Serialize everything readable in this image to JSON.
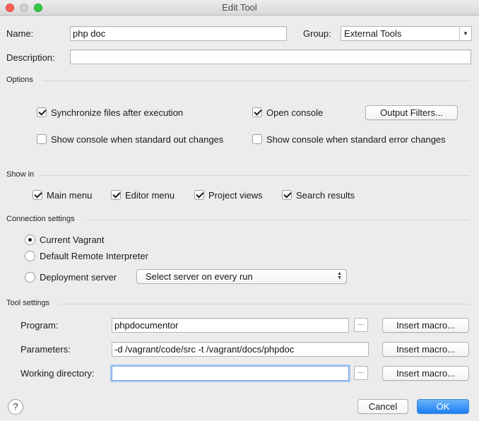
{
  "window": {
    "title": "Edit Tool",
    "close_color": "#fc5f57",
    "minimize_color": "#d0d0d0",
    "zoom_color": "#34c748"
  },
  "general": {
    "name_label": "Name:",
    "name_value": "php doc",
    "group_label": "Group:",
    "group_value": "External Tools",
    "description_label": "Description:",
    "description_value": ""
  },
  "options": {
    "section_title": "Options",
    "sync_files": {
      "label": "Synchronize files after execution",
      "checked": true
    },
    "open_console": {
      "label": "Open console",
      "checked": true
    },
    "output_filters_button": "Output Filters...",
    "show_console_stdout": {
      "label": "Show console when standard out changes",
      "checked": false
    },
    "show_console_stderr": {
      "label": "Show console when standard error changes",
      "checked": false
    }
  },
  "show_in": {
    "section_title": "Show in",
    "main_menu": {
      "label": "Main menu",
      "checked": true
    },
    "editor_menu": {
      "label": "Editor menu",
      "checked": true
    },
    "project_views": {
      "label": "Project views",
      "checked": true
    },
    "search_results": {
      "label": "Search results",
      "checked": true
    }
  },
  "connection": {
    "section_title": "Connection settings",
    "current_vagrant": {
      "label": "Current Vagrant",
      "selected": true
    },
    "default_remote": {
      "label": "Default Remote Interpreter",
      "selected": false
    },
    "deployment_server": {
      "label": "Deployment server",
      "selected": false
    },
    "server_select_value": "Select server on every run"
  },
  "tool_settings": {
    "section_title": "Tool settings",
    "program_label": "Program:",
    "program_value": "phpdocumentor",
    "parameters_label": "Parameters:",
    "parameters_value": "-d /vagrant/code/src -t /vagrant/docs/phpdoc",
    "working_dir_label": "Working directory:",
    "working_dir_value": "",
    "browse_label": "...",
    "insert_macro_label": "Insert macro..."
  },
  "footer": {
    "help_label": "?",
    "cancel_label": "Cancel",
    "ok_label": "OK",
    "ok_color": "#1d7ff4"
  }
}
